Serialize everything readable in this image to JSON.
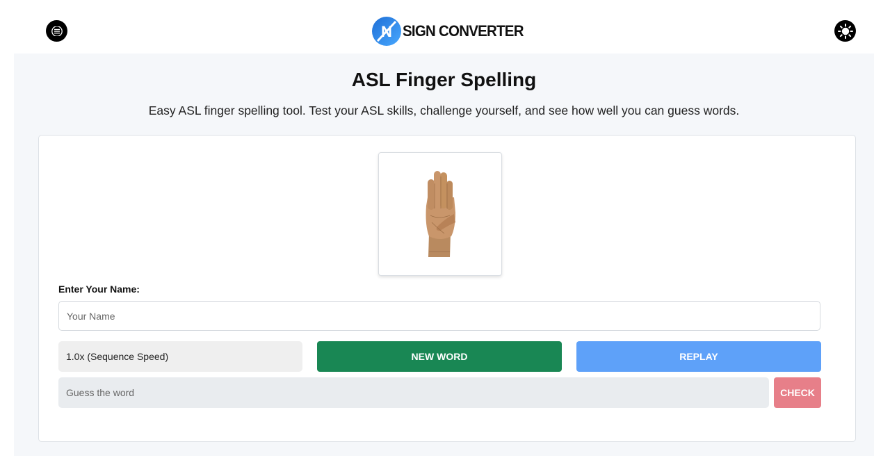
{
  "header": {
    "logo_text": "SIGN CONVERTER",
    "logo_mark_letter": "N",
    "menu_icon": "hamburger-menu-icon",
    "theme_icon": "sun-icon"
  },
  "page": {
    "title": "ASL Finger Spelling",
    "description": "Easy ASL finger spelling tool. Test your ASL skills, challenge yourself, and see how well you can guess words."
  },
  "sign_display": {
    "icon": "asl-hand-sign-b"
  },
  "form": {
    "name_label": "Enter Your Name:",
    "name_placeholder": "Your Name",
    "speed_value": "1.0x (Sequence Speed)",
    "new_word_label": "NEW WORD",
    "replay_label": "REPLAY",
    "guess_placeholder": "Guess the word",
    "check_label": "CHECK"
  },
  "colors": {
    "new_word": "#198754",
    "replay": "#5ea1f9",
    "check": "#e77f89",
    "logo_blue": "#2f8ef0"
  }
}
